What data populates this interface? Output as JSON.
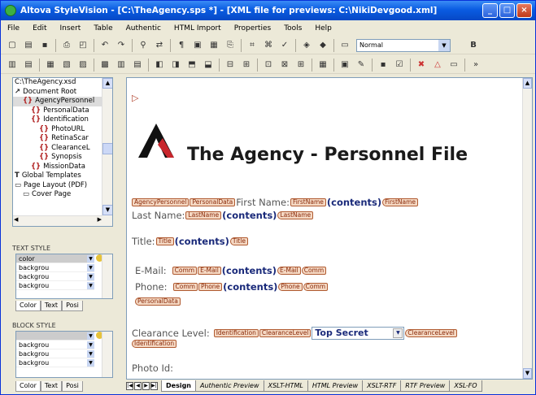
{
  "window": {
    "title": "Altova StyleVision - [C:\\TheAgency.sps *] - [XML file for previews: C:\\NikiDevgood.xml]"
  },
  "menu": [
    "File",
    "Edit",
    "Insert",
    "Table",
    "Authentic",
    "HTML Import",
    "Properties",
    "Tools",
    "Help"
  ],
  "toolbar": {
    "style_combo": "Normal",
    "bold": "B"
  },
  "tree": {
    "items": [
      {
        "label": "C:\\TheAgency.xsd",
        "indent": 0,
        "icon": ""
      },
      {
        "label": "Document Root",
        "indent": 0,
        "icon": "root-icon"
      },
      {
        "label": "AgencyPersonnel",
        "indent": 1,
        "icon": "element-icon",
        "selected": true
      },
      {
        "label": "PersonalData",
        "indent": 2,
        "icon": "element-icon"
      },
      {
        "label": "Identification",
        "indent": 2,
        "icon": "element-icon"
      },
      {
        "label": "PhotoURL",
        "indent": 3,
        "icon": "element-icon"
      },
      {
        "label": "RetinaScar",
        "indent": 3,
        "icon": "element-icon"
      },
      {
        "label": "ClearanceL",
        "indent": 3,
        "icon": "element-icon"
      },
      {
        "label": "Synopsis",
        "indent": 3,
        "icon": "element-icon"
      },
      {
        "label": "MissionData",
        "indent": 2,
        "icon": "element-icon"
      },
      {
        "label": "Global Templates",
        "indent": 0,
        "icon": "template-icon"
      },
      {
        "label": "Page Layout (PDF)",
        "indent": 0,
        "icon": "page-icon"
      },
      {
        "label": "Cover Page",
        "indent": 1,
        "icon": "page-icon"
      }
    ]
  },
  "text_style": {
    "title": "TEXT STYLE",
    "rows": [
      "color",
      "backgrou",
      "backgrou",
      "backgrou"
    ],
    "tabs": [
      "Color",
      "Text",
      "Posi"
    ]
  },
  "block_style": {
    "title": "BLOCK STYLE",
    "rows": [
      "",
      "backgrou",
      "backgrou",
      "backgrou"
    ],
    "tabs": [
      "Color",
      "Text",
      "Posi"
    ]
  },
  "doc": {
    "heading": "The Agency - Personnel File",
    "contents": "(contents)",
    "first_name": "First Name:",
    "last_name": "Last Name:",
    "title": "Title:",
    "email": "E-Mail:",
    "phone": "Phone:",
    "clearance": "Clearance Level:",
    "clearance_value": "Top Secret",
    "photo": "Photo Id:",
    "tags": {
      "agency": "AgencyPersonnel",
      "personal": "PersonalData",
      "first": "FirstName",
      "last": "LastName",
      "title": "Title",
      "comm": "Comm",
      "email": "E-Mail",
      "phone": "Phone",
      "ident": "Identification",
      "clev": "ClearanceLevel"
    }
  },
  "bottom_tabs": [
    "Design",
    "Authentic Preview",
    "XSLT-HTML",
    "HTML Preview",
    "XSLT-RTF",
    "RTF Preview",
    "XSL-FO"
  ],
  "colors": {
    "title_bar": "#0a5ce1",
    "tag_fill": "#f5d9c4",
    "content": "#1a2a7a"
  }
}
